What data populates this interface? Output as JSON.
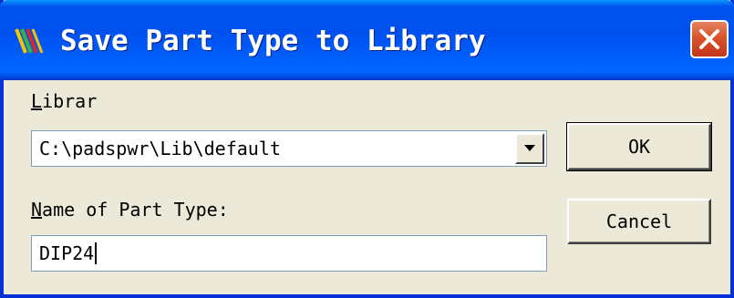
{
  "window": {
    "title": "Save Part Type to Library",
    "app_icon": "pads-logo-icon",
    "close_icon": "close-icon"
  },
  "library": {
    "label_accel": "L",
    "label_rest": "ibrar",
    "selected_value": "C:\\padspwr\\Lib\\default",
    "dropdown_icon": "chevron-down-icon"
  },
  "part_type": {
    "label_accel": "N",
    "label_rest": "ame of Part Type:",
    "value": "DIP24"
  },
  "buttons": {
    "ok_label": "OK",
    "cancel_label": "Cancel"
  },
  "colors": {
    "titlebar": "#0053ee",
    "close_button": "#d9542a",
    "dialog_face": "#ece9d8",
    "field_border": "#7f9db9"
  }
}
